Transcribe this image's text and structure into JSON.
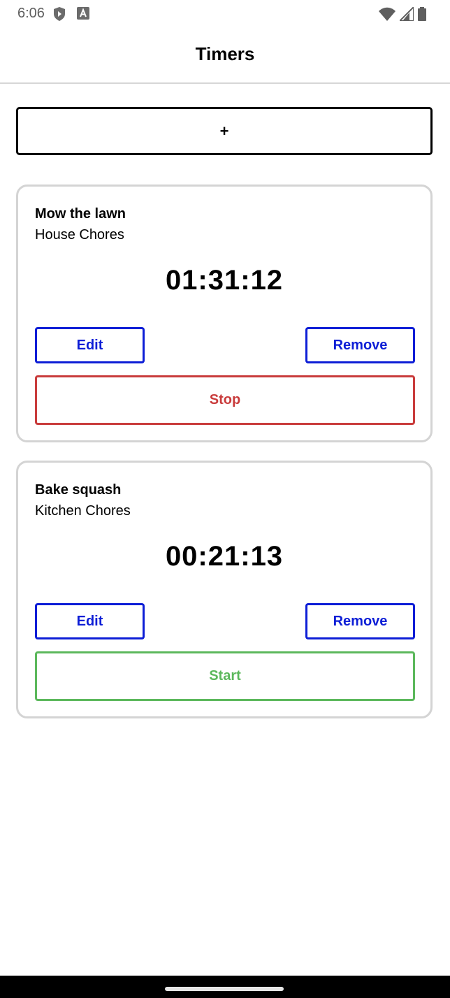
{
  "status_bar": {
    "time": "6:06",
    "left_icons": [
      "shield-play-icon",
      "font-a-icon"
    ],
    "right_icons": [
      "wifi-icon",
      "signal-icon",
      "battery-icon"
    ]
  },
  "app_bar": {
    "title": "Timers"
  },
  "add_button": {
    "label": "+"
  },
  "timers": [
    {
      "name": "Mow the lawn",
      "category": "House Chores",
      "time": "01:31:12",
      "edit_label": "Edit",
      "remove_label": "Remove",
      "action_label": "Stop",
      "action_color": "#c93c3c"
    },
    {
      "name": "Bake squash",
      "category": "Kitchen Chores",
      "time": "00:21:13",
      "edit_label": "Edit",
      "remove_label": "Remove",
      "action_label": "Start",
      "action_color": "#5cb85c"
    }
  ],
  "colors": {
    "accent_blue": "#0d1ed6",
    "card_border": "#d4d4d4"
  }
}
